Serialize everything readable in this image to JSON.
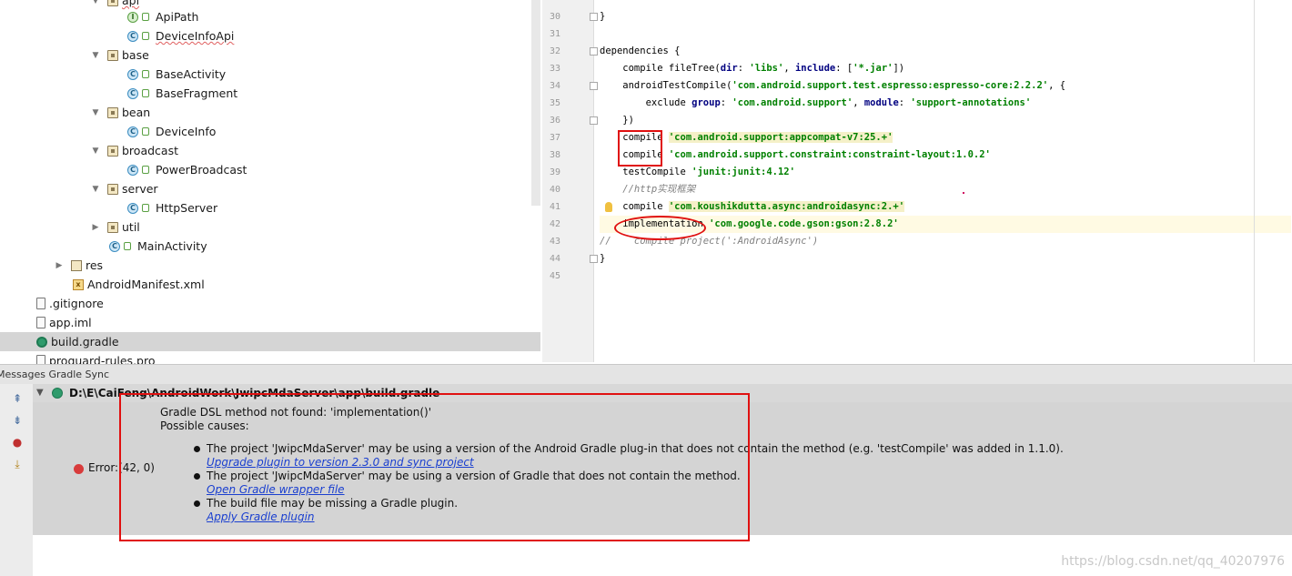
{
  "project_tree": {
    "rows": [
      {
        "label": "api",
        "type": "package",
        "expanded": true
      },
      {
        "label": "ApiPath",
        "type": "interface"
      },
      {
        "label": "DeviceInfoApi",
        "type": "class"
      },
      {
        "label": "base",
        "type": "package",
        "expanded": true
      },
      {
        "label": "BaseActivity",
        "type": "class"
      },
      {
        "label": "BaseFragment",
        "type": "class"
      },
      {
        "label": "bean",
        "type": "package",
        "expanded": true
      },
      {
        "label": "DeviceInfo",
        "type": "class"
      },
      {
        "label": "broadcast",
        "type": "package",
        "expanded": true
      },
      {
        "label": "PowerBroadcast",
        "type": "class"
      },
      {
        "label": "server",
        "type": "package",
        "expanded": true
      },
      {
        "label": "HttpServer",
        "type": "class"
      },
      {
        "label": "util",
        "type": "package",
        "expanded": false
      },
      {
        "label": "MainActivity",
        "type": "class"
      },
      {
        "label": "res",
        "type": "res-folder",
        "expanded": false
      },
      {
        "label": "AndroidManifest.xml",
        "type": "xml"
      },
      {
        "label": ".gitignore",
        "type": "file"
      },
      {
        "label": "app.iml",
        "type": "file"
      },
      {
        "label": "build.gradle",
        "type": "gradle",
        "selected": true
      },
      {
        "label": "proguard-rules.pro",
        "type": "file"
      }
    ]
  },
  "editor": {
    "line_numbers": [
      "30",
      "31",
      "32",
      "33",
      "34",
      "35",
      "36",
      "37",
      "38",
      "39",
      "40",
      "41",
      "42",
      "43",
      "44",
      "45"
    ],
    "current_line": "42",
    "lines": {
      "l30": {
        "t1": "}"
      },
      "l32": {
        "t1": "dependencies {"
      },
      "l33": {
        "t1": "    compile fileTree(",
        "k1": "dir",
        "t2": ": ",
        "s1": "'libs'",
        "t3": ", ",
        "k2": "include",
        "t4": ": [",
        "s2": "'*.jar'",
        "t5": "])"
      },
      "l34": {
        "t1": "    androidTestCompile(",
        "s1": "'com.android.support.test.espresso:espresso-core:2.2.2'",
        "t2": ", {"
      },
      "l35": {
        "t1": "        exclude ",
        "k1": "group",
        "t2": ": ",
        "s1": "'com.android.support'",
        "t3": ", ",
        "k2": "module",
        "t4": ": ",
        "s2": "'support-annotations'"
      },
      "l36": {
        "t1": "    })"
      },
      "l37": {
        "t1": "    compile ",
        "s1": "'com.android.support:appcompat-v7:25.+'"
      },
      "l38": {
        "t1": "    compile ",
        "s1": "'com.android.support.constraint:constraint-layout:1.0.2'"
      },
      "l39": {
        "t1": "    testCompile ",
        "s1": "'junit:junit:4.12'"
      },
      "l40": {
        "c1": "    //http实现框架"
      },
      "l41": {
        "t1": "    compile ",
        "s1": "'com.koushikdutta.async:androidasync:2.+'"
      },
      "l42": {
        "t1": "    implementation ",
        "s1": "'com.google.code.gson:gson:2.8.2'"
      },
      "l43": {
        "c1": "//    compile project(':AndroidAsync')"
      },
      "l44": {
        "t1": "}"
      }
    }
  },
  "messages": {
    "panel_title": "Messages Gradle Sync",
    "file_path": "D:\\E\\CaiFeng\\AndroidWork\\JwipcMdaServer\\app\\build.gradle",
    "error_label": "Error:(42, 0)",
    "headline": "Gradle DSL method not found: 'implementation()'",
    "possible_causes": "Possible causes:",
    "cause_1": "The project 'JwipcMdaServer' may be using a version of the Android Gradle plug-in that does not contain the method (e.g. 'testCompile' was added in 1.1.0).",
    "link_1": "Upgrade plugin to version 2.3.0 and sync project",
    "cause_2": "The project 'JwipcMdaServer' may be using a version of Gradle that does not contain the method.",
    "link_2": "Open Gradle wrapper file",
    "cause_3": "The build file may be missing a Gradle plugin.",
    "link_3": "Apply Gradle plugin"
  },
  "watermark": "https://blog.csdn.net/qq_40207976",
  "colors": {
    "annotation_red": "#e01010",
    "link_blue": "#1a3fd0",
    "string_green": "#008000",
    "keyword_navy": "#000080"
  }
}
